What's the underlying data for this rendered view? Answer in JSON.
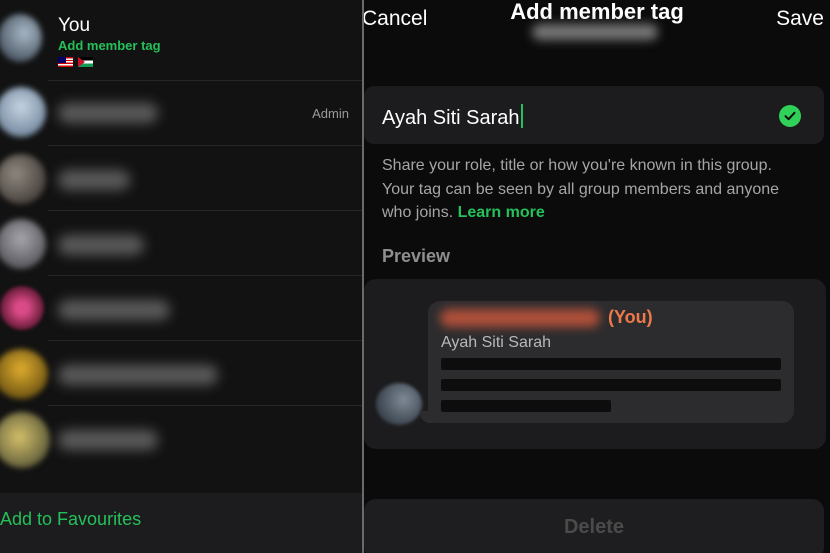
{
  "contacts": {
    "self": {
      "name": "You",
      "tag_action": "Add member tag",
      "flags": [
        "malaysia-flag",
        "palestine-flag"
      ]
    },
    "members": [
      {
        "badge": "Admin",
        "avatar_color": "#9fb2c8"
      },
      {
        "badge": "",
        "avatar_color": "#8b7f76"
      },
      {
        "badge": "",
        "avatar_color": "#9a9aa0"
      },
      {
        "badge": "",
        "avatar_color": "#c2356b"
      },
      {
        "badge": "",
        "avatar_color": "#c79a2a"
      },
      {
        "badge": "",
        "avatar_color": "#b9a24a"
      }
    ],
    "favourites_action": "Add to Favourites"
  },
  "sheet": {
    "cancel_label": "Cancel",
    "title": "Add member tag",
    "save_label": "Save",
    "input_value": "Ayah Siti Sarah",
    "help_text": "Share your role, title or how you're known in this group. Your tag can be seen by all group members and anyone who joins.",
    "learn_more": "Learn more",
    "preview_label": "Preview",
    "preview": {
      "you_label": "(You)",
      "tag_text": "Ayah Siti Sarah"
    },
    "delete_label": "Delete"
  },
  "colors": {
    "accent_green": "#25c05a",
    "you_orange": "#ee7a4a"
  },
  "icons": {
    "input_status": "checkmark-circle-icon"
  }
}
